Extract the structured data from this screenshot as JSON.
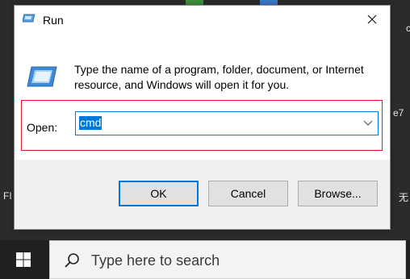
{
  "desktop": {
    "frag_right_top": "e7",
    "frag_left_mid": "FI",
    "frag_right_mid": "无",
    "frag_right_corner": "c"
  },
  "run_dialog": {
    "title": "Run",
    "description": "Type the name of a program, folder, document, or Internet resource, and Windows will open it for you.",
    "open_label": "Open:",
    "open_value": "cmd",
    "buttons": {
      "ok": "OK",
      "cancel": "Cancel",
      "browse": "Browse..."
    }
  },
  "taskbar": {
    "search_placeholder": "Type here to search"
  },
  "icons": {
    "title": "run-icon",
    "close": "close-icon",
    "large": "run-program-icon",
    "dropdown": "chevron-down-icon",
    "start": "windows-logo-icon",
    "search": "search-icon"
  },
  "colors": {
    "accent": "#0078d7",
    "highlight_border": "#e81123",
    "taskbar": "#202020"
  }
}
